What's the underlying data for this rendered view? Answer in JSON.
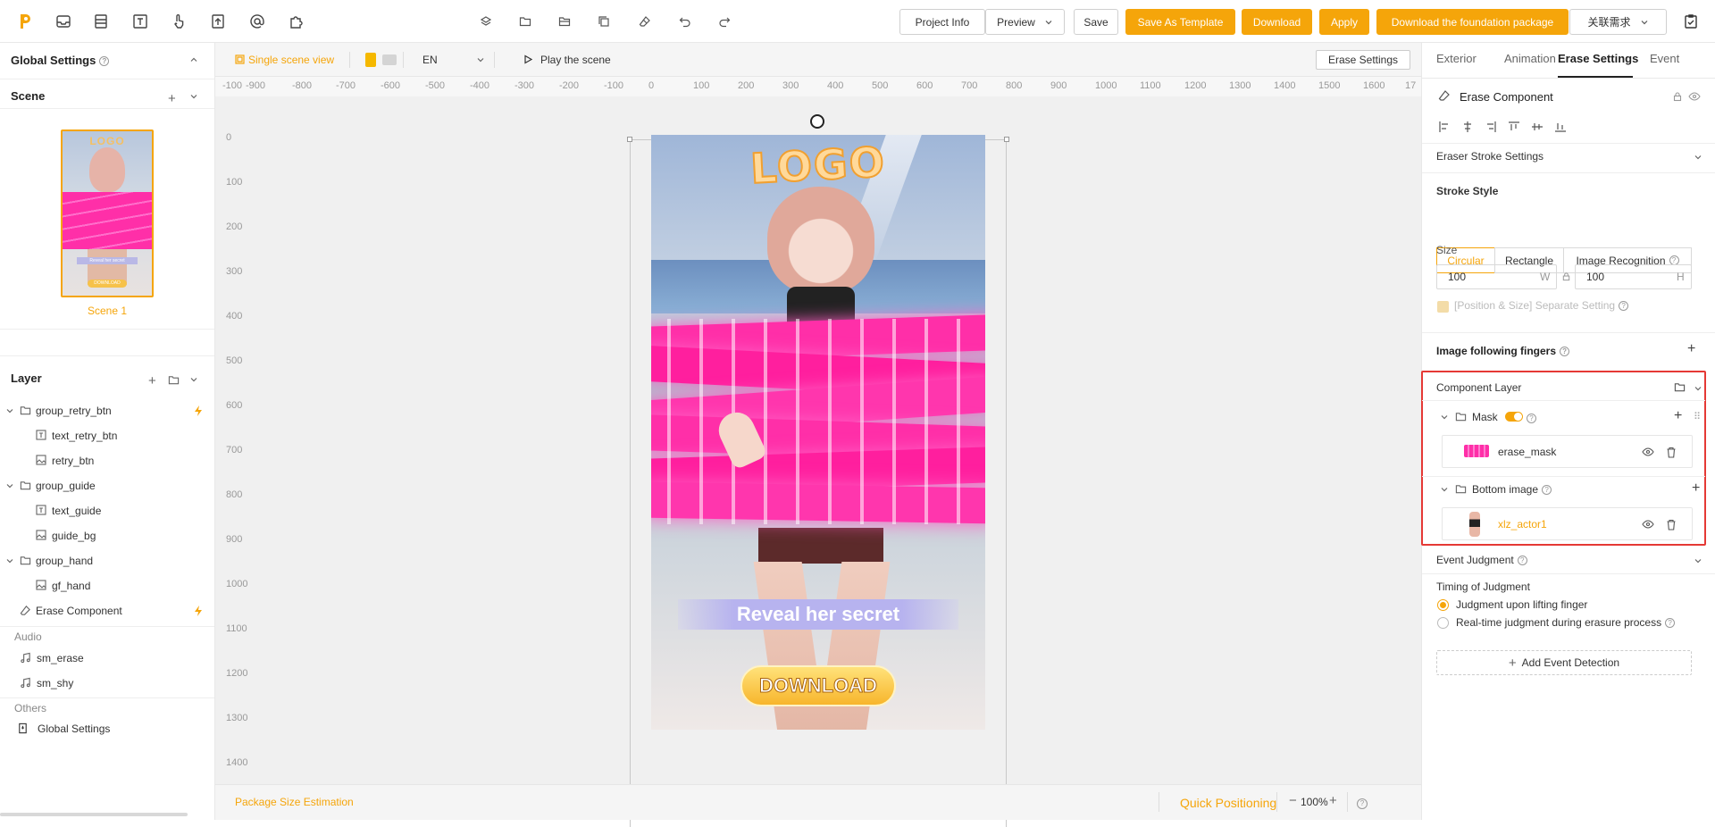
{
  "toolbar": {
    "project_info": "Project Info",
    "preview": "Preview",
    "save": "Save",
    "save_as_template": "Save As Template",
    "download": "Download",
    "apply": "Apply",
    "download_foundation": "Download the foundation package",
    "related_req": "关联需求",
    "left_icons": [
      "logo-icon",
      "inbox-icon",
      "layers-list-icon",
      "text-icon",
      "hand-pointer-icon",
      "file-upload-icon",
      "at-icon",
      "puzzle-icon"
    ],
    "center_icons": [
      "stack-icon",
      "folder-icon",
      "folder-open-icon",
      "copy-icon",
      "eraser-icon",
      "undo-icon",
      "redo-icon"
    ]
  },
  "left": {
    "global_settings": "Global Settings",
    "scene": "Scene",
    "scene_name": "Scene 1",
    "layer": "Layer",
    "layers": [
      {
        "label": "group_retry_btn",
        "type": "group",
        "indent": 0,
        "flash": true
      },
      {
        "label": "text_retry_btn",
        "type": "text",
        "indent": 1
      },
      {
        "label": "retry_btn",
        "type": "image",
        "indent": 1
      },
      {
        "label": "group_guide",
        "type": "group",
        "indent": 0
      },
      {
        "label": "text_guide",
        "type": "text",
        "indent": 1
      },
      {
        "label": "guide_bg",
        "type": "image",
        "indent": 1
      },
      {
        "label": "group_hand",
        "type": "group",
        "indent": 0
      },
      {
        "label": "gf_hand",
        "type": "image",
        "indent": 1
      },
      {
        "label": "Erase Component",
        "type": "erase",
        "indent": 0,
        "flash": true
      }
    ],
    "audio": "Audio",
    "audio_items": [
      "sm_erase",
      "sm_shy"
    ],
    "others": "Others",
    "others_item": "Global Settings"
  },
  "canvas": {
    "single_scene": "Single scene view",
    "lang": "EN",
    "play": "Play the scene",
    "erase_settings_btn": "Erase Settings",
    "ruler_x": [
      "-100",
      "-900",
      "-800",
      "-700",
      "-600",
      "-500",
      "-400",
      "-300",
      "-200",
      "-100",
      "0",
      "100",
      "200",
      "300",
      "400",
      "500",
      "600",
      "700",
      "800",
      "900",
      "1000",
      "1100",
      "1200",
      "1300",
      "1400",
      "1500",
      "1600",
      "17"
    ],
    "ruler_y": [
      "0",
      "100",
      "200",
      "300",
      "400",
      "500",
      "600",
      "700",
      "800",
      "900",
      "1000",
      "1100",
      "1200",
      "1300",
      "1400"
    ],
    "phone_logo": "LOGO",
    "reveal": "Reveal her secret",
    "download_btn": "DOWNLOAD",
    "mini_reveal": "Reveal her secret",
    "mini_download": "DOWNLOAD",
    "package_size": "Package Size Estimation",
    "quick_positioning": "Quick Positioning",
    "zoom": "100%",
    "zoom_minus": "−",
    "zoom_plus": "+"
  },
  "right": {
    "tabs": [
      "Exterior",
      "Animation",
      "Erase Settings",
      "Event"
    ],
    "active_tab": "Erase Settings",
    "component_title": "Erase Component",
    "eraser_stroke": "Eraser Stroke Settings",
    "stroke_style": "Stroke Style",
    "stroke_options": [
      "Circular",
      "Rectangle",
      "Image Recognition"
    ],
    "size": "Size",
    "w_value": "100",
    "w_unit": "W",
    "h_value": "100",
    "h_unit": "H",
    "separate": "[Position & Size] Separate Setting",
    "image_following": "Image following fingers",
    "component_layer": "Component Layer",
    "mask": "Mask",
    "erase_mask": "erase_mask",
    "bottom_image": "Bottom image",
    "xlz_actor": "xlz_actor1",
    "event_judgment": "Event Judgment",
    "timing": "Timing of Judgment",
    "radio1": "Judgment upon lifting finger",
    "radio2": "Real-time judgment during erasure process",
    "add_event": "Add Event Detection"
  },
  "colors": {
    "accent": "#f5a50a",
    "pink": "#ff2fa8",
    "highlight": "#e53935"
  }
}
